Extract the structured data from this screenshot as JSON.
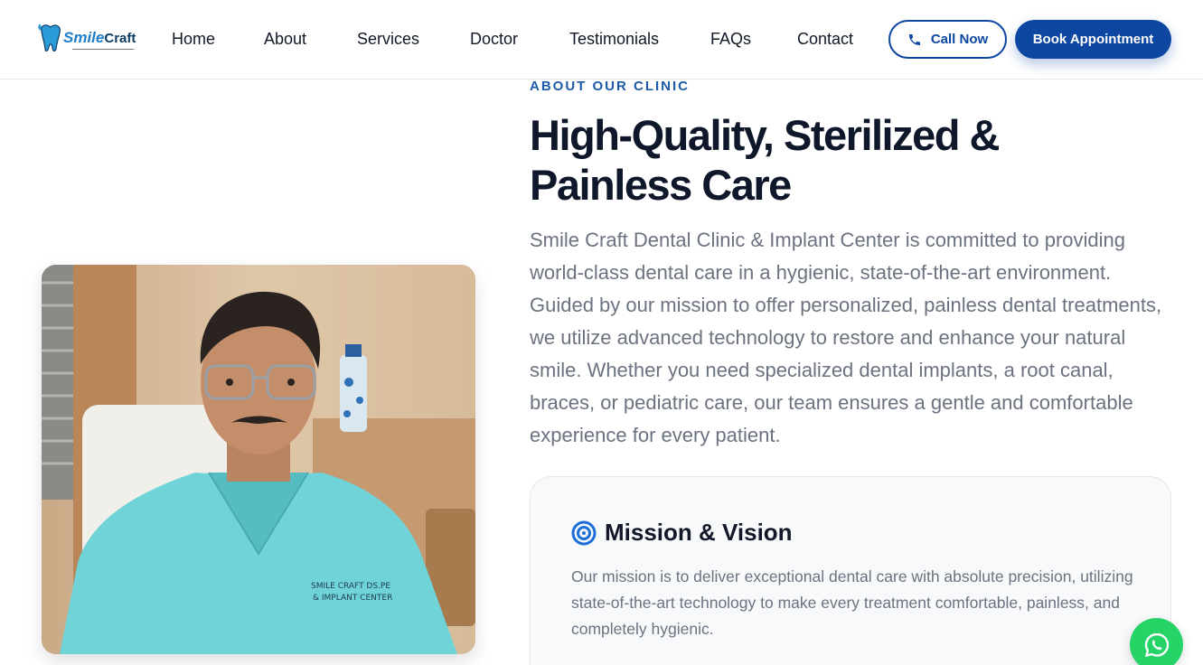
{
  "brand": {
    "logo_text_italic": "Smile",
    "logo_text_bold": "Craft",
    "logo_icon": "tooth-logo-icon"
  },
  "nav": {
    "items": [
      {
        "label": "Home"
      },
      {
        "label": "About"
      },
      {
        "label": "Services"
      },
      {
        "label": "Doctor"
      },
      {
        "label": "Testimonials"
      },
      {
        "label": "FAQs"
      },
      {
        "label": "Contact"
      }
    ],
    "call_label": "Call Now",
    "call_icon": "phone-icon",
    "book_label": "Book Appointment"
  },
  "about": {
    "eyebrow": "ABOUT OUR CLINIC",
    "headline": "High-Quality, Sterilized & Painless Care",
    "paragraph": "Smile Craft Dental Clinic & Implant Center is committed to providing world-class dental care in a hygienic, state-of-the-art environment. Guided by our mission to offer personalized, painless dental treatments, we utilize advanced technology to restore and enhance your natural smile. Whether you need specialized dental implants, a root canal, braces, or pediatric care, our team ensures a gentle and comfortable experience for every patient.",
    "photo_caption_line1": "SMILE CRAFT DS.PE",
    "photo_caption_line2": "& IMPLANT CENTER"
  },
  "mission_card": {
    "icon": "target-icon",
    "title": "Mission & Vision",
    "text": "Our mission is to deliver exceptional dental care with absolute precision, utilizing state-of-the-art technology to make every treatment comfortable, painless, and completely hygienic."
  },
  "whatsapp": {
    "icon": "whatsapp-icon"
  },
  "colors": {
    "primary": "#0d47a1",
    "accent": "#1d5aa8",
    "whatsapp": "#25d366",
    "heading": "#0f172a",
    "body_text": "#6b7280"
  }
}
